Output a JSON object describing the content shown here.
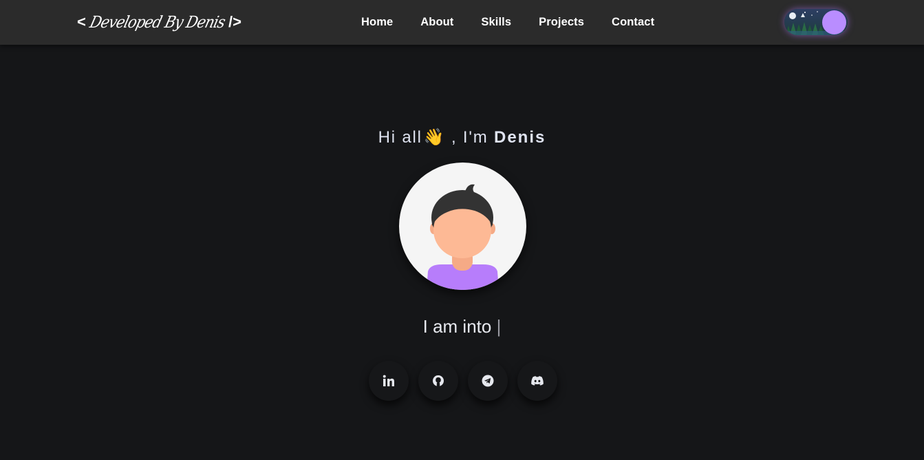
{
  "navbar": {
    "logo_left": "<",
    "logo_text": "Developed By Denis",
    "logo_right": "/>",
    "links": [
      "Home",
      "About",
      "Skills",
      "Projects",
      "Contact"
    ]
  },
  "theme_toggle": {
    "icon": "night-forest-toggle",
    "knob_color": "#b98dff",
    "glow_color": "#b478ff"
  },
  "hero": {
    "greeting_prefix": "Hi all",
    "wave_emoji": "👋",
    "greeting_middle": ", I'm ",
    "name": "Denis",
    "typing_text": "I am into ",
    "typing_cursor": "|"
  },
  "socials": [
    {
      "icon": "linkedin-icon"
    },
    {
      "icon": "github-icon"
    },
    {
      "icon": "telegram-icon"
    },
    {
      "icon": "discord-icon"
    }
  ],
  "colors": {
    "background": "#151618",
    "navbar": "#2b2b2b",
    "accent": "#b98dff",
    "skin": "#fdb995",
    "hair": "#333333",
    "shirt": "#b77dfb"
  }
}
